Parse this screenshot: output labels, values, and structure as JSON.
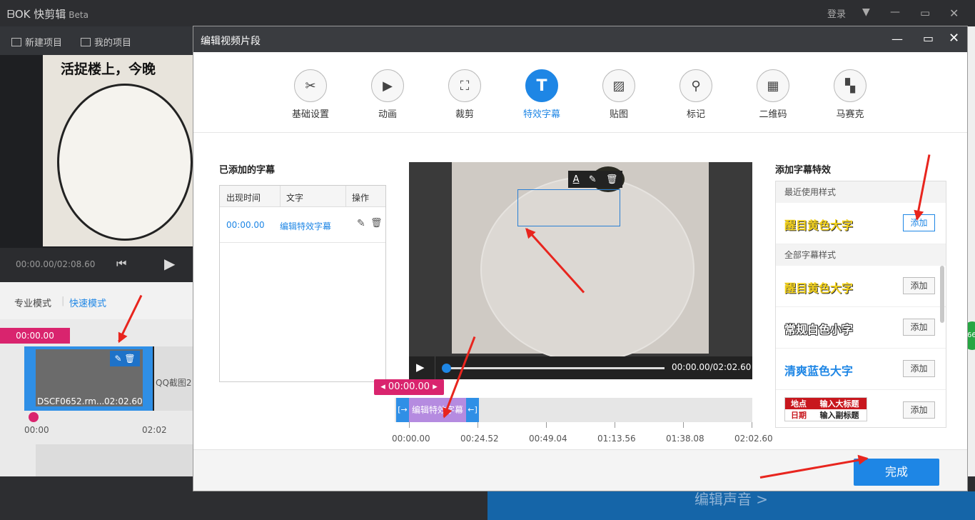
{
  "app": {
    "name": "快剪辑",
    "badge": "Beta",
    "login": "登录"
  },
  "toolbar": {
    "new_project": "新建项目",
    "my_projects": "我的项目"
  },
  "preview": {
    "meme_text": "活捉楼上，今晚",
    "time": "00:00.00/02:08.60"
  },
  "modes": {
    "pro": "专业模式",
    "quick": "快速模式"
  },
  "timeline": {
    "time_tag": "00:00.00",
    "clip1_name": "DSCF0652.rm...",
    "clip1_dur": "02:02.60",
    "clip2_name": "QQ截图2",
    "tick0": "00:00",
    "tick1": "02:02"
  },
  "bottom": {
    "edit_audio": "编辑声音 >"
  },
  "badge_num": "66",
  "modal": {
    "title": "编辑视频片段",
    "tabs": [
      {
        "label": "基础设置",
        "icon": "scissors-icon"
      },
      {
        "label": "动画",
        "icon": "animation-icon"
      },
      {
        "label": "裁剪",
        "icon": "crop-icon"
      },
      {
        "label": "特效字幕",
        "icon": "text-icon"
      },
      {
        "label": "贴图",
        "icon": "image-icon"
      },
      {
        "label": "标记",
        "icon": "pin-icon"
      },
      {
        "label": "二维码",
        "icon": "qrcode-icon"
      },
      {
        "label": "马赛克",
        "icon": "mosaic-icon"
      }
    ],
    "subtitles": {
      "title": "已添加的字幕",
      "headers": [
        "出现时间",
        "文字",
        "操作"
      ],
      "rows": [
        {
          "time": "00:00.00",
          "text": "编辑特效字幕"
        }
      ]
    },
    "video": {
      "time": "00:00.00/02:02.60",
      "progress": 0
    },
    "track": {
      "time_tag": "00:00.00",
      "segment_label": "编辑特效字幕",
      "ticks": [
        "00:00.00",
        "00:24.52",
        "00:49.04",
        "01:13.56",
        "01:38.08",
        "02:02.60"
      ]
    },
    "effects": {
      "title": "添加字幕特效",
      "recent_label": "最近使用样式",
      "all_label": "全部字幕样式",
      "add_label": "添加",
      "recent": [
        {
          "label": "醒目黄色大字",
          "color": "#f6d41c"
        }
      ],
      "all": [
        {
          "label": "醒目黄色大字",
          "color": "#f6d41c"
        },
        {
          "label": "常规白色小字",
          "color": "#ffffff"
        },
        {
          "label": "清爽蓝色大字",
          "color": "#1e86e5"
        }
      ],
      "template": {
        "place": "地点",
        "place_title": "输入大标题",
        "date": "日期",
        "date_title": "输入副标题"
      }
    },
    "done": "完成"
  }
}
